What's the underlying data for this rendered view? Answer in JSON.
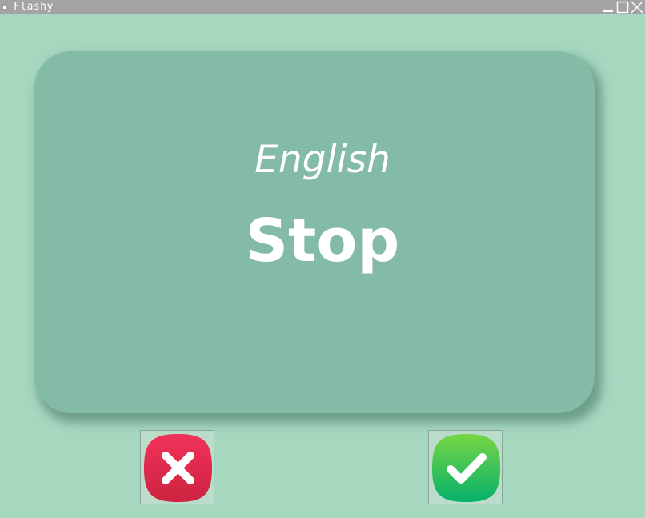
{
  "window": {
    "title": "Flashy",
    "controls": {
      "minimize_icon": "minimize-icon",
      "maximize_icon": "maximize-icon",
      "close_icon": "close-icon"
    }
  },
  "card": {
    "language": "English",
    "word": "Stop",
    "color": "#84bba7"
  },
  "buttons": {
    "wrong": {
      "icon": "cross-icon",
      "color": "#e0264a"
    },
    "right": {
      "icon": "checkmark-icon",
      "color": "#18b85a"
    }
  },
  "colors": {
    "background": "#a6d7bf",
    "titlebar": "#a3a3a3",
    "text": "#ffffff"
  }
}
